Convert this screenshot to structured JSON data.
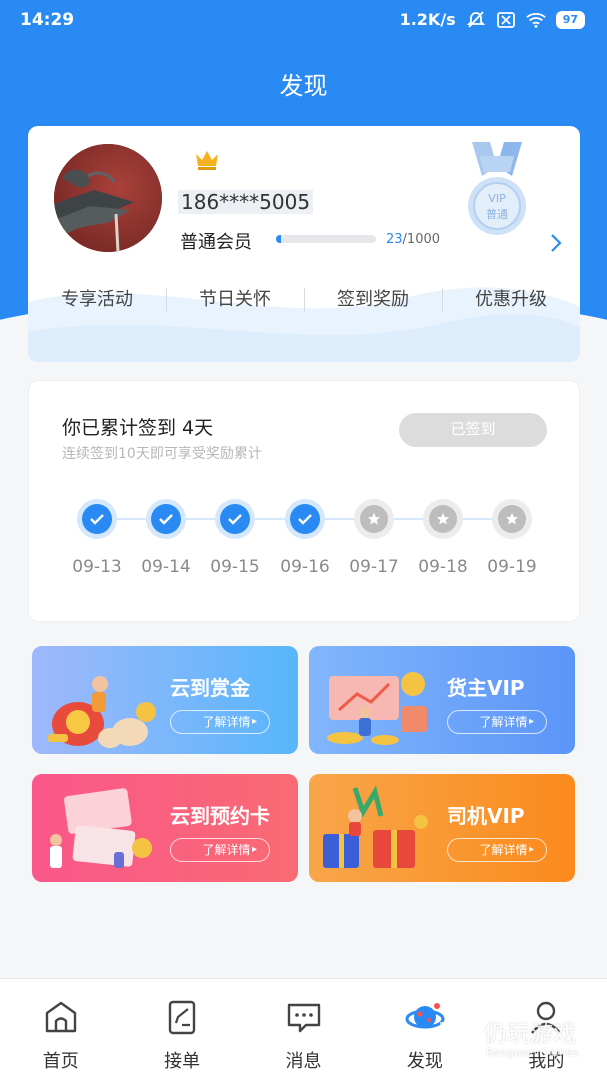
{
  "status_bar": {
    "time": "14:29",
    "speed": "1.2K/s",
    "battery": "97"
  },
  "page": {
    "title": "发现"
  },
  "member": {
    "phone": "186****5005",
    "level": "普通会员",
    "points_current": "23",
    "points_total": "/1000",
    "progress_fraction": 0.023,
    "medal_line1": "VIP",
    "medal_line2": "普通",
    "menu": [
      "专享活动",
      "节日关怀",
      "签到奖励",
      "优惠升级"
    ]
  },
  "checkin": {
    "title": "你已累计签到 4天",
    "subtitle": "连续签到10天即可享受奖励累计",
    "button": "已签到",
    "days": [
      {
        "date": "09-13",
        "checked": true
      },
      {
        "date": "09-14",
        "checked": true
      },
      {
        "date": "09-15",
        "checked": true
      },
      {
        "date": "09-16",
        "checked": true
      },
      {
        "date": "09-17",
        "checked": false
      },
      {
        "date": "09-18",
        "checked": false
      },
      {
        "date": "09-19",
        "checked": false
      }
    ]
  },
  "promos": [
    {
      "title": "云到赏金",
      "button": "了解详情"
    },
    {
      "title": "货主VIP",
      "button": "了解详情"
    },
    {
      "title": "云到预约卡",
      "button": "了解详情"
    },
    {
      "title": "司机VIP",
      "button": "了解详情"
    }
  ],
  "tabs": [
    {
      "label": "首页",
      "icon": "home-icon"
    },
    {
      "label": "接单",
      "icon": "order-icon"
    },
    {
      "label": "消息",
      "icon": "message-icon"
    },
    {
      "label": "发现",
      "icon": "discover-icon"
    },
    {
      "label": "我的",
      "icon": "profile-icon"
    }
  ],
  "watermark": {
    "text": "仍玩游戏",
    "sub": "Rengwan Games"
  },
  "colors": {
    "primary": "#2a8af3",
    "background": "#f5f6f8",
    "disabled_button": "#dcdcdc"
  }
}
